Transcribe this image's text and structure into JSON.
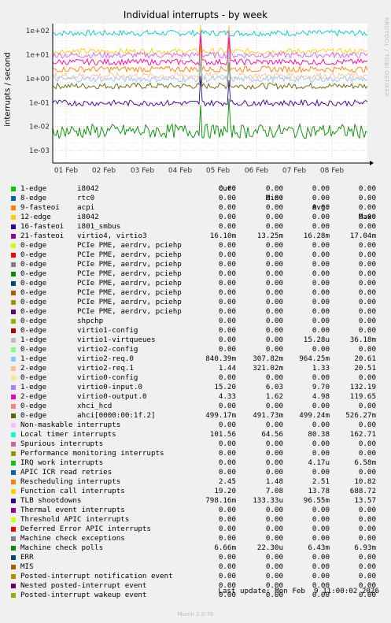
{
  "title": "Individual interrupts - by week",
  "ylabel": "interrupts / second",
  "side_text": "RRDTOOL / TOBI OETIKER",
  "footer": "Munin 2.0.76",
  "last_update": "Last update: Mon Feb  9 11:00:02 2026",
  "table_headers": {
    "cur": "Cur:",
    "min": "Min:",
    "avg": "Avg:",
    "max": "Max:"
  },
  "chart_data": {
    "type": "line",
    "title": "Individual interrupts - by week",
    "ylabel": "interrupts / second",
    "yscale": "log",
    "ylim": [
      0.0003,
      200
    ],
    "yticks": [
      "1e+02",
      "1e+01",
      "1e+00",
      "1e-01",
      "1e-02",
      "1e-03"
    ],
    "yticks_values": [
      100,
      10,
      1,
      0.1,
      0.01,
      0.001
    ],
    "xticks": [
      "01 Feb",
      "02 Feb",
      "03 Feb",
      "04 Feb",
      "05 Feb",
      "06 Feb",
      "07 Feb",
      "08 Feb"
    ],
    "grid": true,
    "series": [
      {
        "name": "Local timer interrupts",
        "color": "#00CCCC",
        "avg": 80.38
      },
      {
        "name": "ahci[0000:00:1f.2]",
        "color": "#666600",
        "avg": 0.499
      },
      {
        "name": "Function call interrupts",
        "color": "#FFCC00",
        "avg": 13.78
      },
      {
        "name": "virtio0-input.0",
        "color": "#CC66FF",
        "avg": 9.7
      },
      {
        "name": "virtio0-output.0",
        "color": "#FF0099",
        "avg": 4.98
      },
      {
        "name": "Rescheduling interrupts",
        "color": "#FF8000",
        "avg": 2.51
      },
      {
        "name": "virtio2-req.1",
        "color": "#FFC08A",
        "avg": 1.33
      },
      {
        "name": "virtio2-req.0",
        "color": "#8FC8FF",
        "avg": 0.964
      },
      {
        "name": "TLB shootdowns",
        "color": "#330099",
        "avg": 0.0966
      },
      {
        "name": "Machine check polls",
        "color": "#008F00",
        "avg": 0.00643
      }
    ]
  },
  "legend": [
    {
      "color": "#00CC00",
      "name": "1-edge",
      "extra": "i8042",
      "cur": "0.00",
      "min": "0.00",
      "avg": "0.00",
      "max": "0.00"
    },
    {
      "color": "#0066B3",
      "name": "8-edge",
      "extra": "rtc0",
      "cur": "0.00",
      "min": "0.00",
      "avg": "0.00",
      "max": "0.00"
    },
    {
      "color": "#FF8000",
      "name": "9-fasteoi",
      "extra": "acpi",
      "cur": "0.00",
      "min": "0.00",
      "avg": "0.00",
      "max": "0.00"
    },
    {
      "color": "#FFCC00",
      "name": "12-edge",
      "extra": "i8042",
      "cur": "0.00",
      "min": "0.00",
      "avg": "0.00",
      "max": "0.00"
    },
    {
      "color": "#330099",
      "name": "16-fasteoi",
      "extra": "i801_smbus",
      "cur": "0.00",
      "min": "0.00",
      "avg": "0.00",
      "max": "0.00"
    },
    {
      "color": "#990099",
      "name": "21-fasteoi",
      "extra": "virtio4, virtio3",
      "cur": "16.10m",
      "min": "13.25m",
      "avg": "16.28m",
      "max": "17.04m"
    },
    {
      "color": "#CCFF00",
      "name": "0-edge",
      "extra": "PCIe PME, aerdrv, pciehp",
      "cur": "0.00",
      "min": "0.00",
      "avg": "0.00",
      "max": "0.00"
    },
    {
      "color": "#FF0000",
      "name": "0-edge",
      "extra": "PCIe PME, aerdrv, pciehp",
      "cur": "0.00",
      "min": "0.00",
      "avg": "0.00",
      "max": "0.00"
    },
    {
      "color": "#808080",
      "name": "0-edge",
      "extra": "PCIe PME, aerdrv, pciehp",
      "cur": "0.00",
      "min": "0.00",
      "avg": "0.00",
      "max": "0.00"
    },
    {
      "color": "#008F00",
      "name": "0-edge",
      "extra": "PCIe PME, aerdrv, pciehp",
      "cur": "0.00",
      "min": "0.00",
      "avg": "0.00",
      "max": "0.00"
    },
    {
      "color": "#00487D",
      "name": "0-edge",
      "extra": "PCIe PME, aerdrv, pciehp",
      "cur": "0.00",
      "min": "0.00",
      "avg": "0.00",
      "max": "0.00"
    },
    {
      "color": "#B35A00",
      "name": "0-edge",
      "extra": "PCIe PME, aerdrv, pciehp",
      "cur": "0.00",
      "min": "0.00",
      "avg": "0.00",
      "max": "0.00"
    },
    {
      "color": "#B38F00",
      "name": "0-edge",
      "extra": "PCIe PME, aerdrv, pciehp",
      "cur": "0.00",
      "min": "0.00",
      "avg": "0.00",
      "max": "0.00"
    },
    {
      "color": "#6B006B",
      "name": "0-edge",
      "extra": "PCIe PME, aerdrv, pciehp",
      "cur": "0.00",
      "min": "0.00",
      "avg": "0.00",
      "max": "0.00"
    },
    {
      "color": "#8FB300",
      "name": "0-edge",
      "extra": "shpchp",
      "cur": "0.00",
      "min": "0.00",
      "avg": "0.00",
      "max": "0.00"
    },
    {
      "color": "#B30000",
      "name": "0-edge",
      "extra": "virtio1-config",
      "cur": "0.00",
      "min": "0.00",
      "avg": "0.00",
      "max": "0.00"
    },
    {
      "color": "#BEBEBE",
      "name": "1-edge",
      "extra": "virtio1-virtqueues",
      "cur": "0.00",
      "min": "0.00",
      "avg": "15.28u",
      "max": "36.18m"
    },
    {
      "color": "#80FF80",
      "name": "0-edge",
      "extra": "virtio2-config",
      "cur": "0.00",
      "min": "0.00",
      "avg": "0.00",
      "max": "0.00"
    },
    {
      "color": "#80C9FF",
      "name": "1-edge",
      "extra": "virtio2-req.0",
      "cur": "840.39m",
      "min": "307.82m",
      "avg": "964.25m",
      "max": "20.61"
    },
    {
      "color": "#FFC080",
      "name": "2-edge",
      "extra": "virtio2-req.1",
      "cur": "1.44",
      "min": "321.02m",
      "avg": "1.33",
      "max": "20.51"
    },
    {
      "color": "#FFE680",
      "name": "0-edge",
      "extra": "virtio0-config",
      "cur": "0.00",
      "min": "0.00",
      "avg": "0.00",
      "max": "0.00"
    },
    {
      "color": "#AA80FF",
      "name": "1-edge",
      "extra": "virtio0-input.0",
      "cur": "15.20",
      "min": "6.03",
      "avg": "9.70",
      "max": "132.19"
    },
    {
      "color": "#EE00CC",
      "name": "2-edge",
      "extra": "virtio0-output.0",
      "cur": "4.33",
      "min": "1.62",
      "avg": "4.98",
      "max": "119.65"
    },
    {
      "color": "#FF8080",
      "name": "0-edge",
      "extra": "xhci_hcd",
      "cur": "0.00",
      "min": "0.00",
      "avg": "0.00",
      "max": "0.00"
    },
    {
      "color": "#666600",
      "name": "0-edge",
      "extra": "ahci[0000:00:1f.2]",
      "cur": "499.17m",
      "min": "491.73m",
      "avg": "499.24m",
      "max": "526.27m"
    },
    {
      "color": "#FFBFFF",
      "name": "Non-maskable interrupts",
      "extra": "",
      "cur": "0.00",
      "min": "0.00",
      "avg": "0.00",
      "max": "0.00"
    },
    {
      "color": "#00FFCC",
      "name": "Local timer interrupts",
      "extra": "",
      "cur": "101.56",
      "min": "64.56",
      "avg": "80.38",
      "max": "162.71"
    },
    {
      "color": "#CC6699",
      "name": "Spurious interrupts",
      "extra": "",
      "cur": "0.00",
      "min": "0.00",
      "avg": "0.00",
      "max": "0.00"
    },
    {
      "color": "#999900",
      "name": "Performance monitoring interrupts",
      "extra": "",
      "cur": "0.00",
      "min": "0.00",
      "avg": "0.00",
      "max": "0.00"
    },
    {
      "color": "#00CC00",
      "name": "IRQ work interrupts",
      "extra": "",
      "cur": "0.00",
      "min": "0.00",
      "avg": "4.17u",
      "max": "6.58m"
    },
    {
      "color": "#0066B3",
      "name": "APIC ICR read retries",
      "extra": "",
      "cur": "0.00",
      "min": "0.00",
      "avg": "0.00",
      "max": "0.00"
    },
    {
      "color": "#FF8000",
      "name": "Rescheduling interrupts",
      "extra": "",
      "cur": "2.45",
      "min": "1.48",
      "avg": "2.51",
      "max": "10.82"
    },
    {
      "color": "#FFCC00",
      "name": "Function call interrupts",
      "extra": "",
      "cur": "19.20",
      "min": "7.08",
      "avg": "13.78",
      "max": "688.72"
    },
    {
      "color": "#330099",
      "name": "TLB shootdowns",
      "extra": "",
      "cur": "798.16m",
      "min": "133.33u",
      "avg": "96.55m",
      "max": "13.57"
    },
    {
      "color": "#990099",
      "name": "Thermal event interrupts",
      "extra": "",
      "cur": "0.00",
      "min": "0.00",
      "avg": "0.00",
      "max": "0.00"
    },
    {
      "color": "#CCFF00",
      "name": "Threshold APIC interrupts",
      "extra": "",
      "cur": "0.00",
      "min": "0.00",
      "avg": "0.00",
      "max": "0.00"
    },
    {
      "color": "#FF0000",
      "name": "Deferred Error APIC interrupts",
      "extra": "",
      "cur": "0.00",
      "min": "0.00",
      "avg": "0.00",
      "max": "0.00"
    },
    {
      "color": "#808080",
      "name": "Machine check exceptions",
      "extra": "",
      "cur": "0.00",
      "min": "0.00",
      "avg": "0.00",
      "max": "0.00"
    },
    {
      "color": "#008F00",
      "name": "Machine check polls",
      "extra": "",
      "cur": "6.66m",
      "min": "22.30u",
      "avg": "6.43m",
      "max": "6.93m"
    },
    {
      "color": "#00487D",
      "name": "ERR",
      "extra": "",
      "cur": "0.00",
      "min": "0.00",
      "avg": "0.00",
      "max": "0.00"
    },
    {
      "color": "#B35A00",
      "name": "MIS",
      "extra": "",
      "cur": "0.00",
      "min": "0.00",
      "avg": "0.00",
      "max": "0.00"
    },
    {
      "color": "#B38F00",
      "name": "Posted-interrupt notification event",
      "extra": "",
      "cur": "0.00",
      "min": "0.00",
      "avg": "0.00",
      "max": "0.00"
    },
    {
      "color": "#6B006B",
      "name": "Nested posted-interrupt event",
      "extra": "",
      "cur": "0.00",
      "min": "0.00",
      "avg": "0.00",
      "max": "0.00"
    },
    {
      "color": "#8FB300",
      "name": "Posted-interrupt wakeup event",
      "extra": "",
      "cur": "0.00",
      "min": "0.00",
      "avg": "0.00",
      "max": "0.00"
    }
  ]
}
